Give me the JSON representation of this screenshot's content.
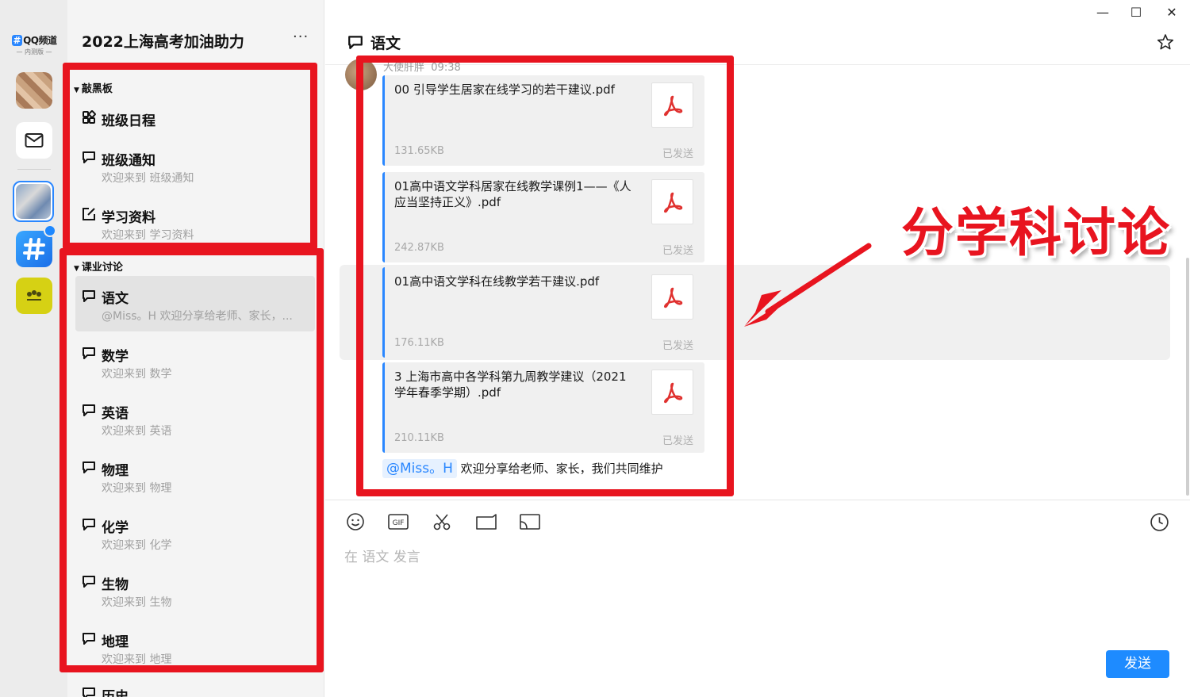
{
  "app": {
    "logo_text": "QQ频道",
    "logo_hash": "#",
    "logo_sub": "— 内测版 —"
  },
  "guild": {
    "title": "2022上海高考加油助力",
    "more": "···"
  },
  "categories": [
    {
      "label": "敲黑板"
    },
    {
      "label": "课业讨论"
    }
  ],
  "channels": [
    {
      "name": "班级日程",
      "sub": "",
      "icon": "grid-icon"
    },
    {
      "name": "班级通知",
      "sub": "欢迎来到 班级通知",
      "icon": "chat-bubble-icon"
    },
    {
      "name": "学习资料",
      "sub": "欢迎来到 学习资料",
      "icon": "edit-doc-icon"
    },
    {
      "name": "语文",
      "sub": "@Miss。H 欢迎分享给老师、家长，...",
      "icon": "chat-bubble-icon",
      "active": true
    },
    {
      "name": "数学",
      "sub": "欢迎来到 数学",
      "icon": "chat-bubble-icon"
    },
    {
      "name": "英语",
      "sub": "欢迎来到 英语",
      "icon": "chat-bubble-icon"
    },
    {
      "name": "物理",
      "sub": "欢迎来到 物理",
      "icon": "chat-bubble-icon"
    },
    {
      "name": "化学",
      "sub": "欢迎来到 化学",
      "icon": "chat-bubble-icon"
    },
    {
      "name": "生物",
      "sub": "欢迎来到 生物",
      "icon": "chat-bubble-icon"
    },
    {
      "name": "地理",
      "sub": "欢迎来到 地理",
      "icon": "chat-bubble-icon"
    },
    {
      "name": "历史",
      "sub": "",
      "icon": "chat-bubble-icon"
    }
  ],
  "chat": {
    "title": "语文",
    "sender_name": "大使肝胖",
    "sender_time": "09:38",
    "files": [
      {
        "name": "00 引导学生居家在线学习的若干建议.pdf",
        "size": "131.65KB",
        "status": "已发送"
      },
      {
        "name": "01高中语文学科居家在线教学课例1——《人应当坚持正义》.pdf",
        "size": "242.87KB",
        "status": "已发送"
      },
      {
        "name": "01高中语文学科在线教学若干建议.pdf",
        "size": "176.11KB",
        "status": "已发送"
      },
      {
        "name": "3 上海市高中各学科第九周教学建议（2021学年春季学期）.pdf",
        "size": "210.11KB",
        "status": "已发送"
      }
    ],
    "mention_tag": "@Miss。H",
    "mention_text": "欢迎分享给老师、家长，我们共同维护"
  },
  "composer": {
    "placeholder": "在 语文 发言",
    "send_label": "发送",
    "tools": [
      "emoji-icon",
      "gif-icon",
      "scissors-icon",
      "folder-icon",
      "screen-share-icon",
      "clock-icon"
    ]
  },
  "window": {
    "minimize": "—",
    "maximize": "☐",
    "close": "✕"
  },
  "annotation": {
    "text": "分学科讨论",
    "color": "#e8141f"
  },
  "colors": {
    "accent": "#1e8bff",
    "annotation_red": "#e8141f"
  }
}
